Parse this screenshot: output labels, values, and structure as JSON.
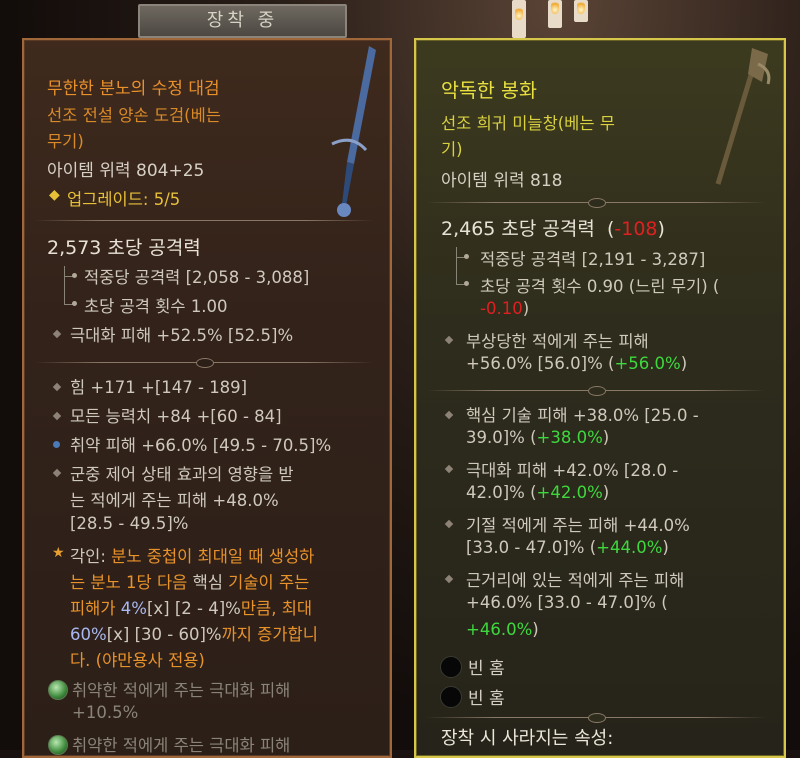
{
  "header": {
    "equipped_tab": "장착 중"
  },
  "left": {
    "name": "무한한 분노의 수정 대검",
    "type_line1": "선조 전설 양손 도검(베는",
    "type_line2": "무기)",
    "item_power": "아이템 위력 804+25",
    "upgrade": "업그레이드: 5/5",
    "dps": "2,573 초당 공격력",
    "damage_per_hit": "적중당 공격력 [2,058 - 3,088]",
    "attack_speed": "초당 공격 횟수 1.00",
    "implicit": "극대화 피해 +52.5% [52.5]%",
    "affixes": [
      {
        "text": "힘 +171 +[147 - 189]"
      },
      {
        "text": "모든 능력치 +84 +[60 - 84]"
      },
      {
        "text": "취약 피해 +66.0% [49.5 - 70.5]%"
      },
      {
        "line1": "군중 제어 상태 효과의 영향을 받",
        "line2": "는 적에게 주는 피해 +48.0%",
        "line3": "[28.5 - 49.5]%"
      }
    ],
    "aspect": {
      "l1_a": "각인: ",
      "l1_b": "분노 중첩이 최대일 때 생성하",
      "l2_a": "는 분노 1당 다음 ",
      "l2_b": "핵심",
      "l2_c": " 기술이 주는",
      "l3_a": "피해가 ",
      "l3_b": "4%",
      "l3_c": "[x] [2 - 4]%",
      "l3_d": "만큼, 최대",
      "l4_a": "60%",
      "l4_b": "[x] [30 - 60]%",
      "l4_c": "까지 증가합니",
      "l5": "다. (야만용사 전용)"
    },
    "gem1_l1": "취약한 적에게 주는 극대화 피해",
    "gem1_l2": "+10.5%",
    "gem2_l1": "취약한 적에게 주는 극대화 피해"
  },
  "right": {
    "name": "악독한 봉화",
    "type_line1": "선조 희귀 미늘창(베는 무",
    "type_line2": "기)",
    "item_power": "아이템 위력 818",
    "dps": "2,465 초당 공격력",
    "dps_diff": "-108",
    "damage_per_hit": "적중당 공격력 [2,191 - 3,287]",
    "attack_speed_l1": "초당 공격 횟수 0.90 (느린 무기) (",
    "attack_speed_diff": "-0.10",
    "implicit_l1": "부상당한 적에게 주는 피해",
    "implicit_l2": "+56.0% [56.0]% (",
    "implicit_green": "+56.0%",
    "affixes": [
      {
        "line1": "핵심 기술 피해 +38.0% [25.0 -",
        "line2": "39.0]% (",
        "green": "+38.0%"
      },
      {
        "line1": "극대화 피해 +42.0% [28.0 -",
        "line2": "42.0]% (",
        "green": "+42.0%"
      },
      {
        "line1": "기절 적에게 주는 피해 +44.0%",
        "line2": "[33.0 - 47.0]% (",
        "green": "+44.0%"
      },
      {
        "line1": "근거리에 있는 적에게 주는 피해",
        "line2": "+46.0% [33.0 - 47.0]% (",
        "green": "+46.0%"
      }
    ],
    "socket1": "빈 홈",
    "socket2": "빈 홈",
    "lost_on_equip": "장착 시 사라지는 속성:"
  },
  "colors": {
    "legendary": "#e8902c",
    "rare": "#e8e040",
    "positive": "#3ed83e",
    "negative": "#e02020"
  }
}
